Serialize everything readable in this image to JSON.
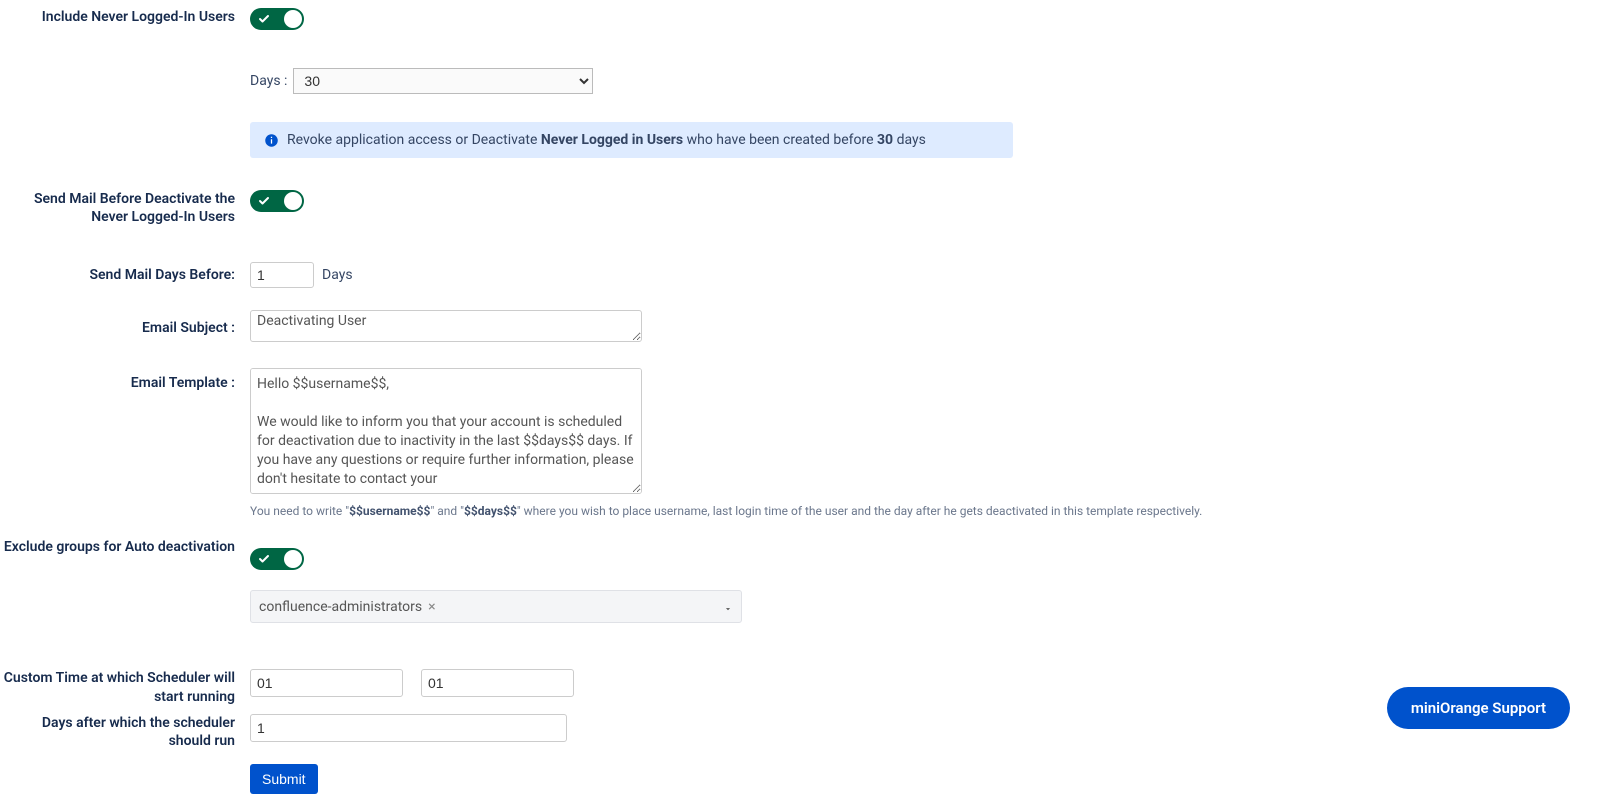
{
  "form": {
    "includeNeverLoggedIn": {
      "label": "Include Never Logged-In Users",
      "on": true
    },
    "daysLabel": "Days :",
    "daysValue": "30",
    "info": {
      "pre": "Revoke application access or Deactivate ",
      "bold1": "Never Logged in Users",
      "mid": " who have been created before ",
      "bold2": "30",
      "post": " days"
    },
    "sendMailBefore": {
      "label": "Send Mail Before Deactivate the Never Logged-In Users",
      "on": true
    },
    "sendMailDays": {
      "label": "Send Mail Days Before:",
      "value": "1",
      "suffix": "Days"
    },
    "emailSubject": {
      "label": "Email Subject :",
      "value": "Deactivating User"
    },
    "emailTemplate": {
      "label": "Email Template :",
      "value": "Hello $$username$$,\n\nWe would like to inform you that your account is scheduled for deactivation due to inactivity in the last $$days$$ days. If you have any questions or require further information, please don't hesitate to contact your "
    },
    "helperPre": "You need to write \"",
    "helperB1": "$$username$$",
    "helperMid1": "\" and \"",
    "helperB2": "$$days$$",
    "helperPost": "\" where you wish to place username, last login time of the user and the day after he gets deactivated in this template respectively.",
    "excludeGroups": {
      "label": "Exclude groups for Auto deactivation",
      "on": true,
      "selected": "confluence-administrators"
    },
    "customTime": {
      "label": "Custom Time at which Scheduler will start running",
      "hour": "01",
      "minute": "01"
    },
    "daysAfter": {
      "label": "Days after which the scheduler should run",
      "value": "1"
    },
    "submit": "Submit"
  },
  "support": "miniOrange Support"
}
